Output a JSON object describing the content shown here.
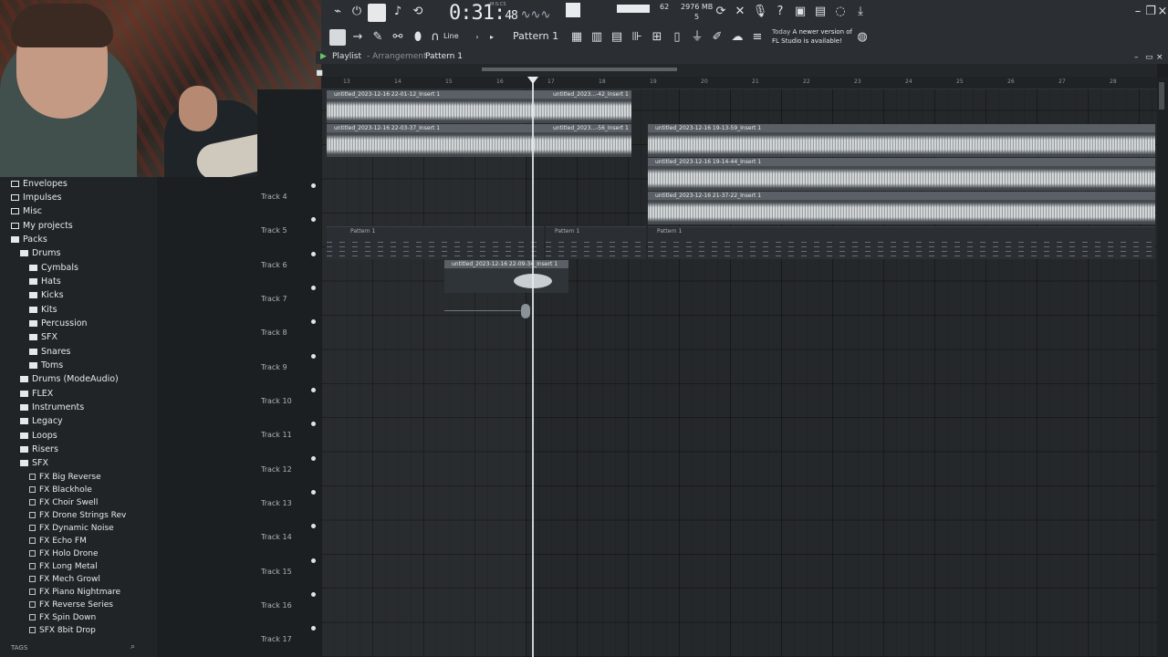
{
  "toolbar": {
    "time_main": "0:31",
    "time_sub": "48",
    "time_unit_label": "M:S:CS",
    "cpu": "62",
    "memory": "2976 MB",
    "polyphony": "5",
    "snap_mode": "Line",
    "pattern": "Pattern 1",
    "news_line1": "Today",
    "news_line1b": "A newer version of",
    "news_line2": "FL Studio is available!"
  },
  "playlist": {
    "title": "Playlist",
    "subtitle": "- Arrangement",
    "pattern": "Pattern 1",
    "ruler": [
      "13",
      "14",
      "15",
      "16",
      "17",
      "18",
      "19",
      "20",
      "21",
      "22",
      "23",
      "24",
      "25",
      "26",
      "27",
      "28"
    ]
  },
  "tracks": [
    "Track 4",
    "Track 5",
    "Track 6",
    "Track 7",
    "Track 8",
    "Track 9",
    "Track 10",
    "Track 11",
    "Track 12",
    "Track 13",
    "Track 14",
    "Track 15",
    "Track 16",
    "Track 17"
  ],
  "clips": {
    "c1": "untitled_2023-12-16 22-01-12_Insert 1",
    "c2": "untitled_2023...-42_Insert 1",
    "c3": "untitled_2023-12-16 22-03-37_Insert 1",
    "c4": "untitled_2023...-56_Insert 1",
    "c5": "untitled_2023-12-16 19-13-59_Insert 1",
    "c6": "untitled_2023-12-16 19-14-44_Insert 1",
    "c7": "untitled_2023-12-16 21-37-22_Insert 1",
    "c8": "untitled_2023-12-16 22-09-34_Insert 1",
    "p1": "Pattern 1",
    "p2": "Pattern 1",
    "p3": "Pattern 1"
  },
  "browser": {
    "items": [
      "Envelopes",
      "Impulses",
      "Misc",
      "My projects",
      "Packs",
      "Drums",
      "Cymbals",
      "Hats",
      "Kicks",
      "Kits",
      "Percussion",
      "SFX",
      "Snares",
      "Toms",
      "Drums (ModeAudio)",
      "FLEX",
      "Instruments",
      "Legacy",
      "Loops",
      "Risers",
      "SFX"
    ],
    "sfx_files": [
      "FX Big Reverse",
      "FX Blackhole",
      "FX Choir Swell",
      "FX Drone Strings Rev",
      "FX Dynamic Noise",
      "FX Echo FM",
      "FX Holo Drone",
      "FX Long Metal",
      "FX Mech Growl",
      "FX Piano Nightmare",
      "FX Reverse Series",
      "FX Spin Down",
      "SFX 8bit Drop"
    ],
    "tags_label": "TAGS"
  },
  "colors": {
    "background": "#1b1d1f",
    "toolbar": "#2b2f33",
    "clip_header": "#5a6065",
    "playhead": "#e8ecef",
    "play_icon": "#6ac36a"
  }
}
